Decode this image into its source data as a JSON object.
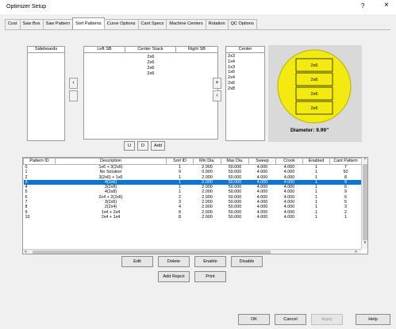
{
  "window": {
    "title": "Optimizer Setup",
    "help_glyph": "?",
    "close_glyph": "×"
  },
  "tabs": [
    "Cost",
    "Saw Box",
    "Saw Pattern",
    "Sort Patterns",
    "Curve Options",
    "Cant Specs",
    "Machine Centers",
    "Rotation",
    "QC Options"
  ],
  "active_tab": "Sort Patterns",
  "sideboards": {
    "header": "Sideboards"
  },
  "left_arrow": "‹",
  "stack": {
    "headers": [
      "Left SB",
      "Center Stack",
      "Right SB"
    ],
    "center_items": [
      "2x6",
      "2x6",
      "2x6",
      "2x6"
    ]
  },
  "right_arrows": [
    "+",
    "‹"
  ],
  "center": {
    "header": "Center",
    "items": [
      "2x3",
      "1x4",
      "1x3",
      "1x6",
      "2x4",
      "2x6",
      "2x8"
    ]
  },
  "preview": {
    "boards": [
      "2x6",
      "2x6",
      "2x6",
      "2x6"
    ],
    "diameter_label": "Diameter: 9.99\"",
    "circle_color": "#f2ea10"
  },
  "stack_buttons": {
    "up": "U",
    "down": "D",
    "add": "Add"
  },
  "table": {
    "headers": [
      "Pattern ID",
      "Description",
      "Sort ID",
      "Min Dia.",
      "Max Dia.",
      "Sweep",
      "Crook",
      "Enabled",
      "Cant Pattern"
    ],
    "rows": [
      [
        "0",
        "1x6 + 3(2x6)",
        "1",
        "2.000",
        "50.000",
        "4.000",
        "4.000",
        "1",
        "7"
      ],
      [
        "1",
        "No Solution",
        "9",
        "0.000",
        "50.000",
        "4.000",
        "4.000",
        "1",
        "50"
      ],
      [
        "2",
        "3(2x6) + 1x6",
        "1",
        "2.000",
        "50.000",
        "4.000",
        "4.000",
        "1",
        "8"
      ],
      [
        "3",
        "4(2x6)",
        "1",
        "2.000",
        "50.000",
        "4.000",
        "4.000",
        "1",
        "9"
      ],
      [
        "4",
        "3(2x8)",
        "1",
        "2.000",
        "50.000",
        "4.000",
        "4.000",
        "1",
        "6"
      ],
      [
        "5",
        "4(2x8)",
        "1",
        "2.000",
        "50.000",
        "4.000",
        "4.000",
        "1",
        "9"
      ],
      [
        "6",
        "2x4 + 2(2x6)",
        "2",
        "2.000",
        "50.000",
        "4.000",
        "4.000",
        "1",
        "6"
      ],
      [
        "7",
        "3(2x6)",
        "3",
        "2.000",
        "50.000",
        "4.000",
        "4.000",
        "1",
        "5"
      ],
      [
        "8",
        "2(2x4)",
        "4",
        "2.000",
        "50.000",
        "4.000",
        "4.000",
        "1",
        "3"
      ],
      [
        "9",
        "1x4 + 2x4",
        "8",
        "2.000",
        "50.000",
        "4.000",
        "4.000",
        "1",
        "2"
      ],
      [
        "10",
        "2x4 + 1x4",
        "8",
        "2.000",
        "50.000",
        "4.000",
        "4.000",
        "1",
        "1"
      ]
    ],
    "selected_index": 3,
    "scroll_glyphs": {
      "up": "^",
      "down": "v",
      "left": "<",
      "right": ">"
    }
  },
  "actions": {
    "edit": "Edit",
    "delete": "Delete",
    "enable": "Enable",
    "disable": "Disable",
    "add_reject": "Add Reject",
    "print": "Print"
  },
  "footer": {
    "ok": "OK",
    "cancel": "Cancel",
    "apply": "Apply",
    "help": "Help"
  }
}
